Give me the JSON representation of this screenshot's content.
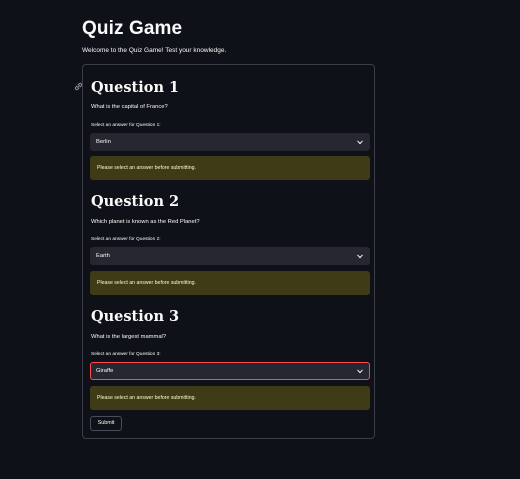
{
  "page": {
    "title": "Quiz Game",
    "subtitle": "Welcome to the Quiz Game! Test your knowledge."
  },
  "questions": [
    {
      "title": "Question 1",
      "text": "What is the capital of France?",
      "label": "Select an answer for Question 1:",
      "selected": "Berlin",
      "warning": "Please select an answer before submitting."
    },
    {
      "title": "Question 2",
      "text": "Which planet is known as the Red Planet?",
      "label": "Select an answer for Question 2:",
      "selected": "Earth",
      "warning": "Please select an answer before submitting."
    },
    {
      "title": "Question 3",
      "text": "What is the largest mammal?",
      "label": "Select an answer for Question 3:",
      "selected": "Giraffe",
      "warning": "Please select an answer before submitting."
    }
  ],
  "form": {
    "submit_label": "Submit"
  },
  "colors": {
    "background": "#0e1117",
    "select_bg": "#262730",
    "focus_border": "#ff4b4b",
    "warning_bg": "#3e3b16",
    "warning_text": "#fffacd"
  },
  "icons": {
    "anchor": "link-icon",
    "select": "chevron-down-icon"
  }
}
